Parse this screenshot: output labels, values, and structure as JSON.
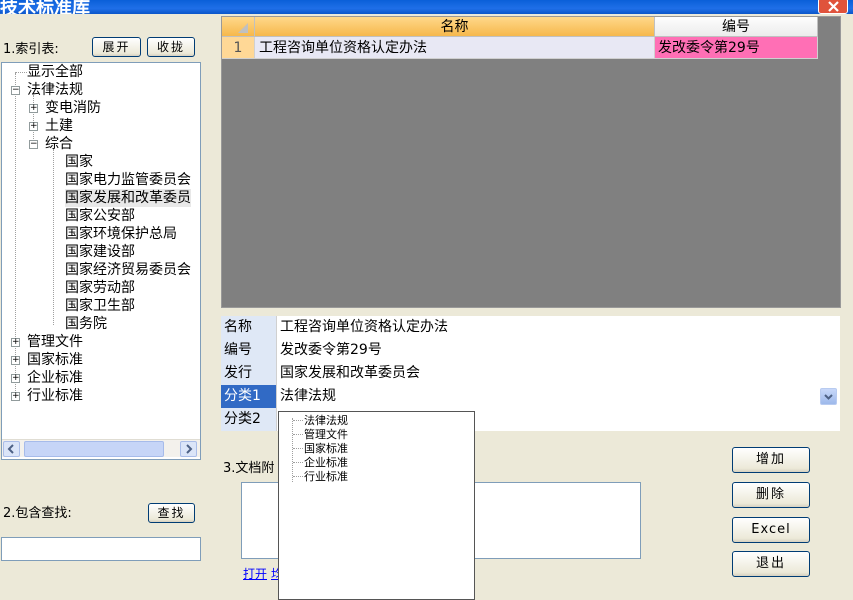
{
  "window": {
    "title": "技术标准库"
  },
  "index": {
    "label": "1.索引表:",
    "expand_label": "展开",
    "collapse_label": "收拢",
    "tree": {
      "show_all": "显示全部",
      "law": "法律法规",
      "law_children": [
        "变电消防",
        "土建",
        "综合"
      ],
      "综合_children": [
        "国家",
        "国家电力监管委员会",
        "国家发展和改革委员",
        "国家公安部",
        "国家环境保护总局",
        "国家建设部",
        "国家经济贸易委员会",
        "国家劳动部",
        "国家卫生部",
        "国务院"
      ],
      "roots": [
        "管理文件",
        "国家标准",
        "企业标准",
        "行业标准"
      ]
    }
  },
  "search": {
    "label": "2.包含查找:",
    "button": "查找"
  },
  "grid": {
    "columns": [
      "名称",
      "编号"
    ],
    "rows": [
      {
        "num": "1",
        "name": "工程咨询单位资格认定办法",
        "code": "发改委令第29号"
      }
    ]
  },
  "details": [
    {
      "key": "名称",
      "value": "工程咨询单位资格认定办法"
    },
    {
      "key": "编号",
      "value": "发改委令第29号"
    },
    {
      "key": "发行",
      "value": "国家发展和改革委员会"
    },
    {
      "key": "分类1",
      "value": "法律法规"
    },
    {
      "key": "分类2",
      "value": ""
    }
  ],
  "dropdown_options": [
    "法律法规",
    "管理文件",
    "国家标准",
    "企业标准",
    "行业标准"
  ],
  "attachments": {
    "label": "3.文档附",
    "open_link": "打开",
    "link2": "均"
  },
  "actions": {
    "add": "增加",
    "delete": "删除",
    "excel": "Excel",
    "exit": "退出"
  },
  "colors": {
    "code_cell": "#ff6fb5",
    "row_header": "#ffd896",
    "selected_key": "#316ac5"
  }
}
